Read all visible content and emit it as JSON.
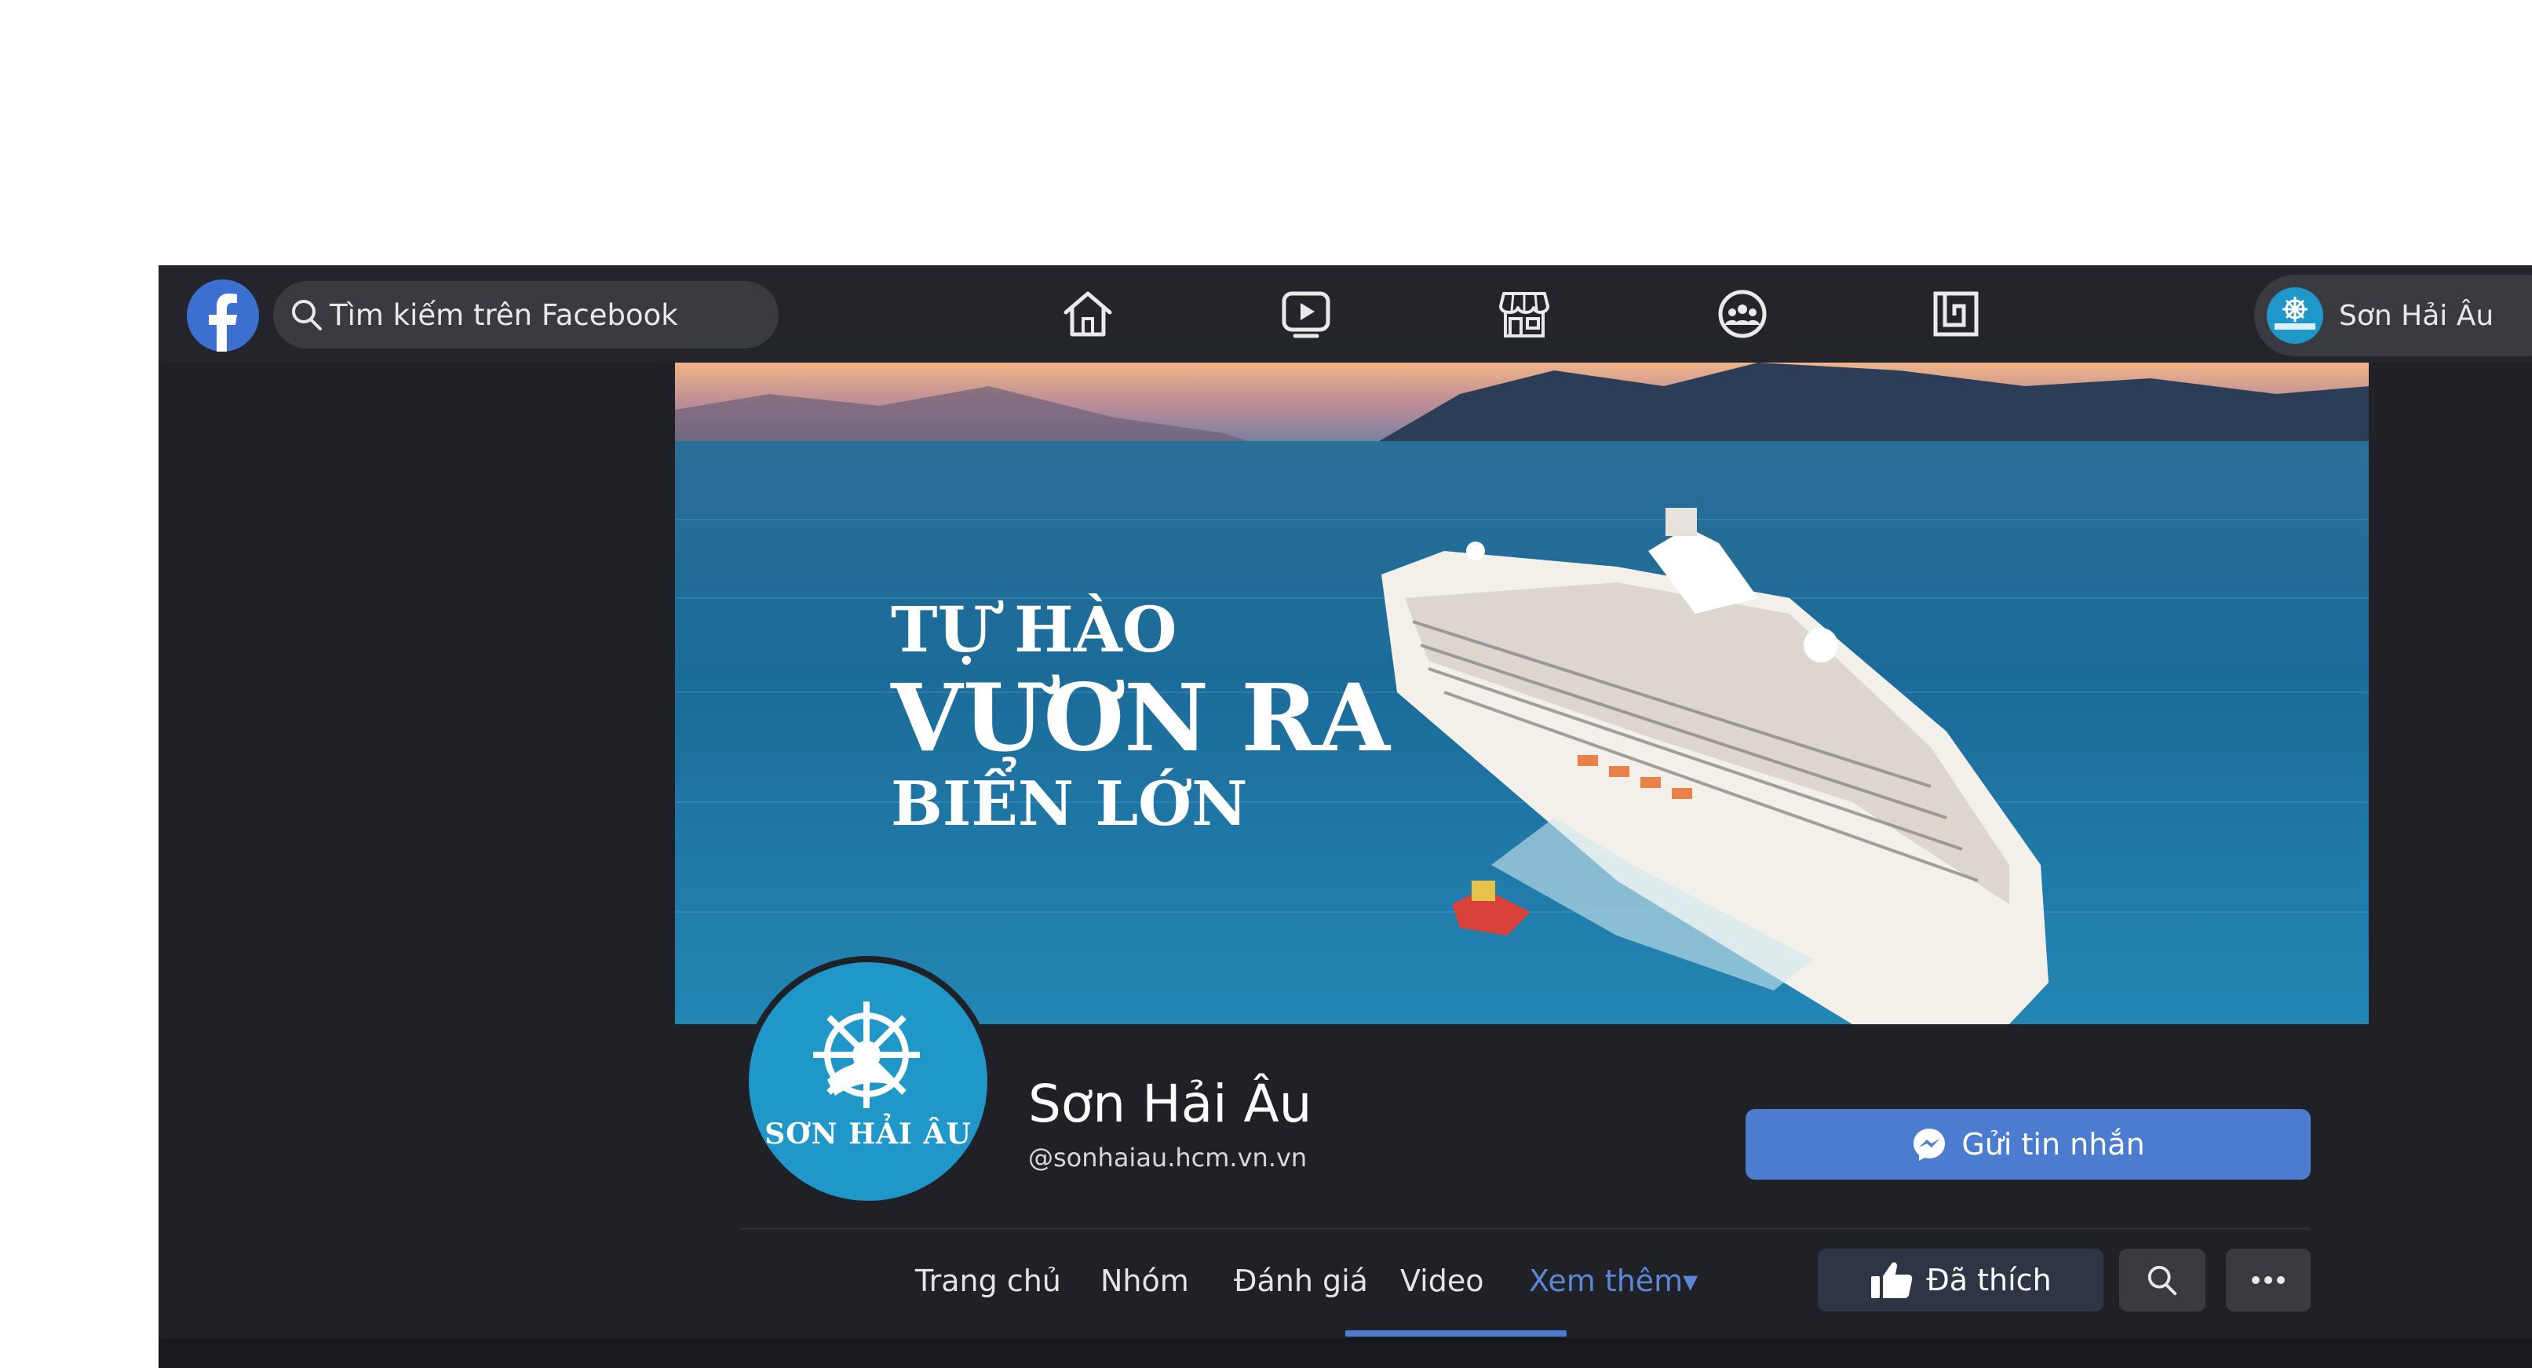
{
  "topbar": {
    "search_placeholder": "Tìm kiếm trên Facebook",
    "nav_icons": [
      "home-icon",
      "watch-icon",
      "marketplace-icon",
      "groups-icon",
      "gaming-icon"
    ],
    "profile_name": "Sơn Hải Âu"
  },
  "cover": {
    "slogan_line1": "TỰ HÀO",
    "slogan_line2": "VƯƠN RA",
    "slogan_line3": "BIỂN LỚN"
  },
  "page": {
    "avatar_logo_text": "SƠN HẢI ÂU",
    "name": "Sơn Hải Âu",
    "handle": "@sonhaiau.hcm.vn.vn",
    "message_button": "Gửi tin nhắn"
  },
  "tabs": [
    {
      "label": "Trang chủ",
      "active": false
    },
    {
      "label": "Nhóm",
      "active": false
    },
    {
      "label": "Đánh giá",
      "active": false
    },
    {
      "label": "Video",
      "active": false
    },
    {
      "label": "Xem thêm▾",
      "active": true
    }
  ],
  "actions": {
    "liked_label": "Đã thích"
  },
  "colors": {
    "background": "#202126",
    "topbar": "#23252a",
    "accent": "#4b7ccf",
    "brand_blue": "#1f97c9"
  }
}
